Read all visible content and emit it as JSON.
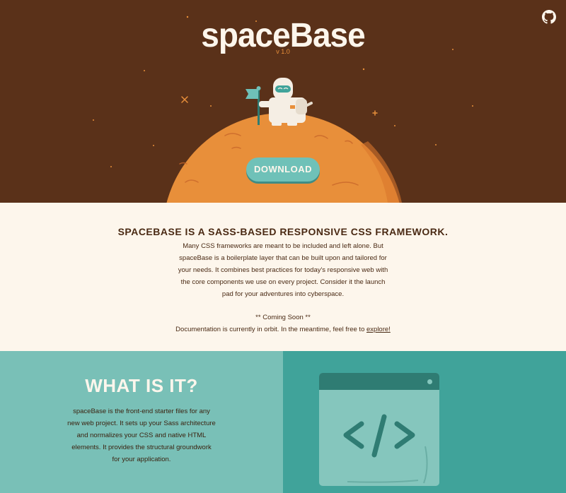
{
  "hero": {
    "logo": "spaceBase",
    "version": "v 1.0",
    "download_label": "DOWNLOAD",
    "github_icon": "github-icon",
    "colors": {
      "sky": "#5a3119",
      "planet": "#e88f3a",
      "accent": "#6fc1b8"
    }
  },
  "intro": {
    "heading": "spaceBase is a Sass-based responsive CSS framework.",
    "body": "Many CSS frameworks are meant to be included and left alone. But spaceBase is a boilerplate layer that can be built upon and tailored for your needs. It combines best practices for today's responsive web with the core components we use on every project. Consider it the launch pad for your adventures into cyberspace.",
    "coming_soon": "** Coming Soon **",
    "doc_text": "Documentation is currently in orbit. In the meantime, feel free to ",
    "explore_link": "explore!"
  },
  "what": {
    "heading": "WHAT IS IT?",
    "body": "spaceBase is the front-end starter files for any new web project. It sets up your Sass architecture and normalizes your CSS and native HTML elements. It provides the structural groundwork for your application.",
    "code_icon": "code-icon"
  }
}
